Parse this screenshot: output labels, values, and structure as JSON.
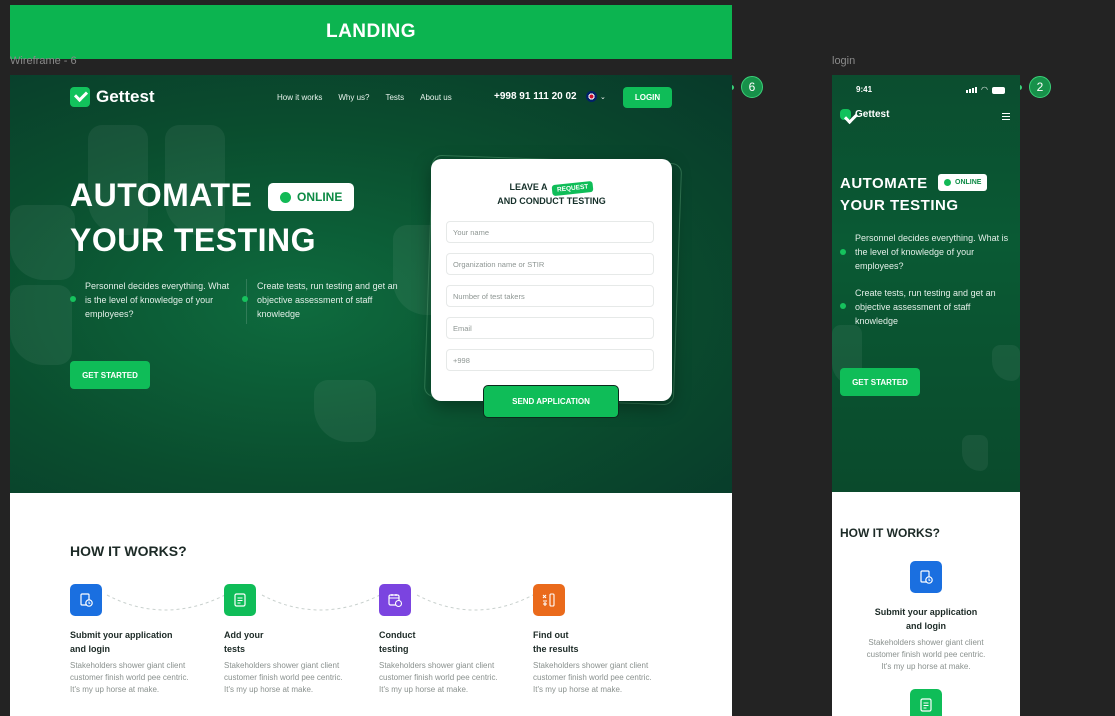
{
  "banner": {
    "title": "LANDING"
  },
  "frames": {
    "desktop_label": "Wireframe - 6",
    "desktop_badge": "6",
    "mobile_label": "login",
    "mobile_badge": "2"
  },
  "desktop": {
    "logo": "Gettest",
    "nav": [
      "How it works",
      "Why us?",
      "Tests",
      "About us"
    ],
    "phone": "+998 91 111 20 02",
    "login": "LOGIN",
    "hero": {
      "line1": "AUTOMATE",
      "line2": "YOUR TESTING",
      "online": "ONLINE",
      "feature1": "Personnel decides everything. What is the level of knowledge of your employees?",
      "feature2": "Create tests, run testing and get an objective assessment of staff knowledge",
      "cta": "GET STARTED"
    },
    "form": {
      "title_pre": "LEAVE A",
      "tag": "REQUEST",
      "title_post": "AND CONDUCT TESTING",
      "placeholders": [
        "Your name",
        "Organization name or STIR",
        "Number of test takers",
        "Email",
        "+998"
      ],
      "submit": "SEND APPLICATION"
    },
    "how": {
      "title": "HOW IT WORKS?",
      "steps": [
        {
          "title1": "Submit your application",
          "title2": "and login",
          "desc": [
            "Stakeholders shower giant client",
            "customer finish world pee centric.",
            "It's my up horse at make."
          ],
          "color": "#1a6fe0",
          "icon": "document-clock-icon"
        },
        {
          "title1": "Add your",
          "title2": "tests",
          "desc": [
            "Stakeholders shower giant client",
            "customer finish world pee centric.",
            "It's my up horse at make."
          ],
          "color": "#0fbd58",
          "icon": "checklist-icon"
        },
        {
          "title1": "Conduct",
          "title2": "testing",
          "desc": [
            "Stakeholders shower giant client",
            "customer finish world pee centric.",
            "It's my up horse at make."
          ],
          "color": "#7b44e0",
          "icon": "calendar-clock-icon"
        },
        {
          "title1": "Find out",
          "title2": "the results",
          "desc": [
            "Stakeholders shower giant client",
            "customer finish world pee centric.",
            "It's my up horse at make."
          ],
          "color": "#ea6a1b",
          "icon": "results-icon"
        }
      ]
    }
  },
  "mobile": {
    "time": "9:41",
    "logo": "Gettest",
    "hero": {
      "line1": "AUTOMATE",
      "line2": "YOUR TESTING",
      "online": "ONLINE",
      "feature1": "Personnel decides everything. What is the level of knowledge of your employees?",
      "feature2": "Create tests, run testing and get an objective assessment of staff knowledge",
      "cta": "GET STARTED"
    },
    "how": {
      "title": "HOW IT WORKS?",
      "step_title1": "Submit your application",
      "step_title2": "and login",
      "desc": [
        "Stakeholders shower giant client",
        "customer finish world pee centric.",
        "It's my up horse at make."
      ]
    }
  }
}
